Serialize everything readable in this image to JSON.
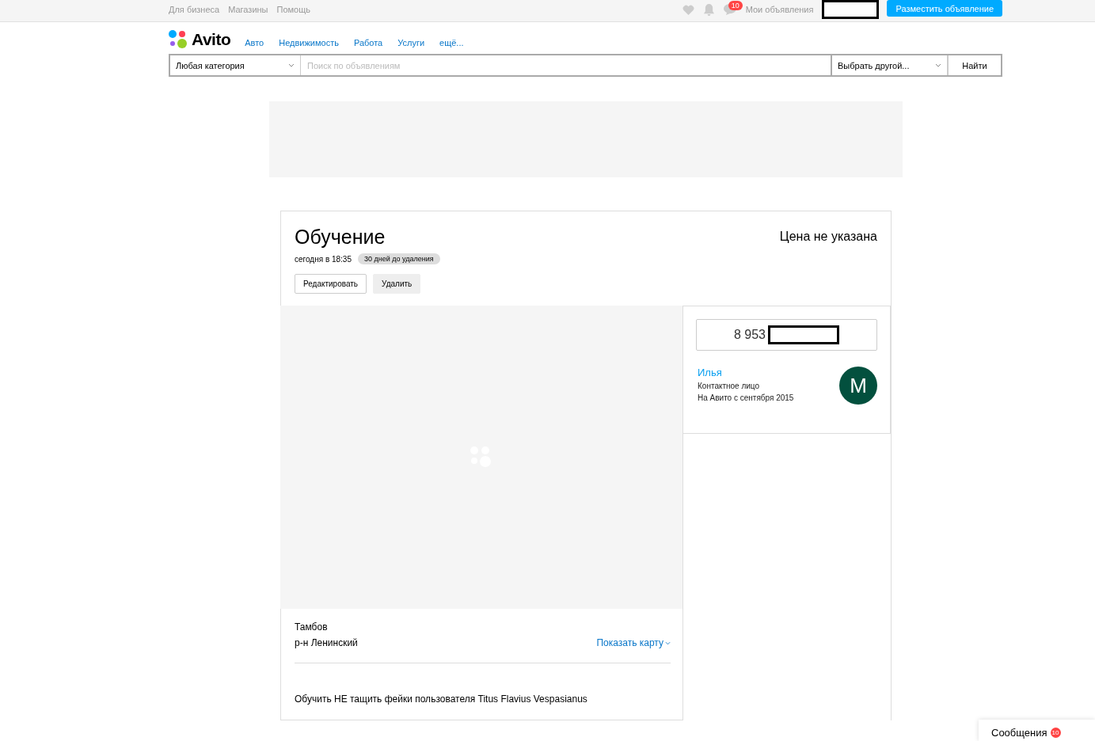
{
  "top_bar": {
    "links": [
      "Для бизнеса",
      "Магазины",
      "Помощь"
    ],
    "messages_badge": "10",
    "my_ads": "Мои объявления",
    "post_button": "Разместить объявление"
  },
  "header": {
    "logo": "Avito",
    "nav": [
      "Авто",
      "Недвижимость",
      "Работа",
      "Услуги",
      "ещё..."
    ]
  },
  "search": {
    "category": "Любая категория",
    "placeholder": "Поиск по объявлениям",
    "region": "Выбрать другой...",
    "button": "Найти"
  },
  "ad": {
    "title": "Обучение",
    "price": "Цена не указана",
    "date": "сегодня в 18:35",
    "expiry": "30 дней до удаления",
    "buttons": [
      "Редактировать",
      "Удалить"
    ],
    "phone": "8 953",
    "seller": {
      "name": "Илья",
      "role": "Контактное лицо",
      "since": "На Авито с сентября 2015",
      "avatar": "M"
    },
    "city": "Тамбов",
    "district": "р-н Ленинский",
    "map_link": "Показать карту",
    "description": "Обучить НЕ тащить фейки пользователя Titus Flavius Vespasianus"
  },
  "messenger": {
    "label": "Сообщения",
    "badge": "10"
  }
}
